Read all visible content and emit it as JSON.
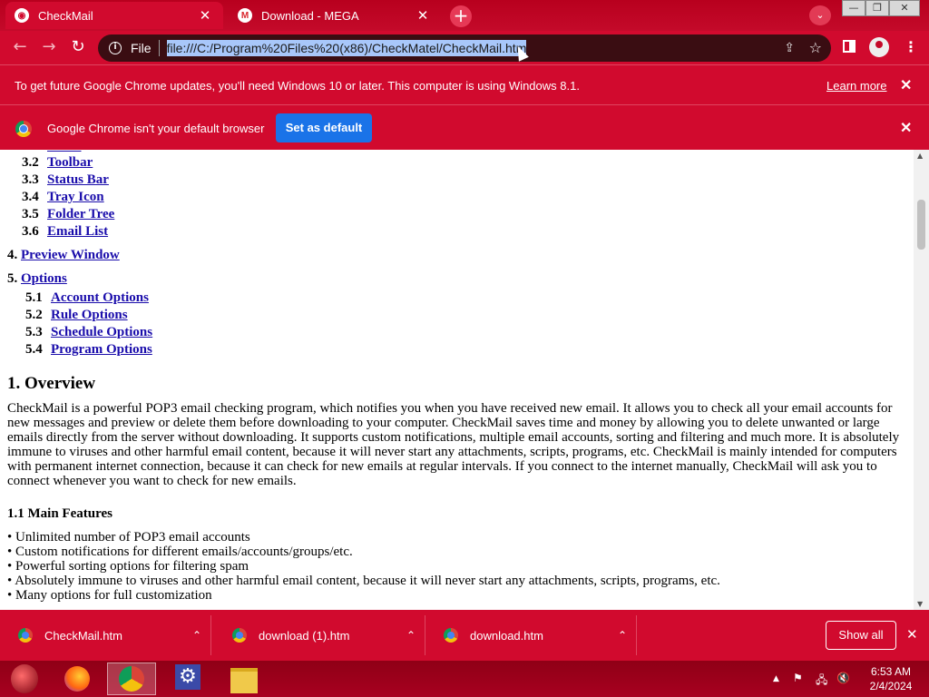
{
  "tabs": [
    {
      "title": "CheckMail",
      "favicon": "checkmail-icon",
      "active": true
    },
    {
      "title": "Download - MEGA",
      "favicon": "mega-icon",
      "favicon_text": "M",
      "active": false
    }
  ],
  "toolbar": {
    "info_chip": "File",
    "url": "file:///C:/Program%20Files%20(x86)/CheckMatel/CheckMail.htm"
  },
  "infobars": {
    "update_text": "To get future Google Chrome updates, you'll need Windows 10 or later. This computer is using Windows 8.1.",
    "learn_more": "Learn more",
    "default_text": "Google Chrome isn't your default browser",
    "set_default": "Set as default"
  },
  "page": {
    "toc_sub_3": [
      {
        "num": "3.2",
        "label": "Toolbar"
      },
      {
        "num": "3.3",
        "label": "Status Bar"
      },
      {
        "num": "3.4",
        "label": "Tray Icon"
      },
      {
        "num": "3.5",
        "label": "Folder Tree"
      },
      {
        "num": "3.6",
        "label": "Email List"
      }
    ],
    "toc_4": {
      "num": "4.",
      "label": "Preview Window"
    },
    "toc_5": {
      "num": "5.",
      "label": "Options"
    },
    "toc_sub_5": [
      {
        "num": "5.1",
        "label": "Account Options"
      },
      {
        "num": "5.2",
        "label": "Rule Options"
      },
      {
        "num": "5.3",
        "label": "Schedule Options"
      },
      {
        "num": "5.4",
        "label": "Program Options"
      }
    ],
    "overview_heading": "1. Overview",
    "overview_text": "CheckMail is a powerful POP3 email checking program, which notifies you when you have received new email. It allows you to check all your email accounts for new messages and preview or delete them before downloading to your computer. CheckMail saves time and money by allowing you to delete unwanted or large emails directly from the server without downloading. It supports custom notifications, multiple email accounts, sorting and filtering and much more. It is absolutely immune to viruses and other harmful email content, because it will never start any attachments, scripts, programs, etc. CheckMail is mainly intended for computers with permanent internet connection, because it can check for new emails at regular intervals. If you connect to the internet manually, CheckMail will ask you to connect whenever you want to check for new emails.",
    "features_heading": "1.1 Main Features",
    "features": [
      "Unlimited number of POP3 email accounts",
      "Custom notifications for different emails/accounts/groups/etc.",
      "Powerful sorting options for filtering spam",
      "Absolutely immune to viruses and other harmful email content, because it will never start any attachments, scripts, programs, etc.",
      "Many options for full customization"
    ]
  },
  "downloads": {
    "items": [
      {
        "name": "CheckMail.htm"
      },
      {
        "name": "download (1).htm"
      },
      {
        "name": "download.htm"
      }
    ],
    "show_all": "Show all"
  },
  "taskbar": {
    "apps": [
      "firefox-icon",
      "chrome-icon",
      "settings-icon",
      "file-explorer-icon"
    ],
    "time": "6:53 AM",
    "date": "2/4/2024"
  },
  "colors": {
    "accent": "#d10a2e",
    "link": "#1a0dab",
    "button_blue": "#1a73e8"
  }
}
